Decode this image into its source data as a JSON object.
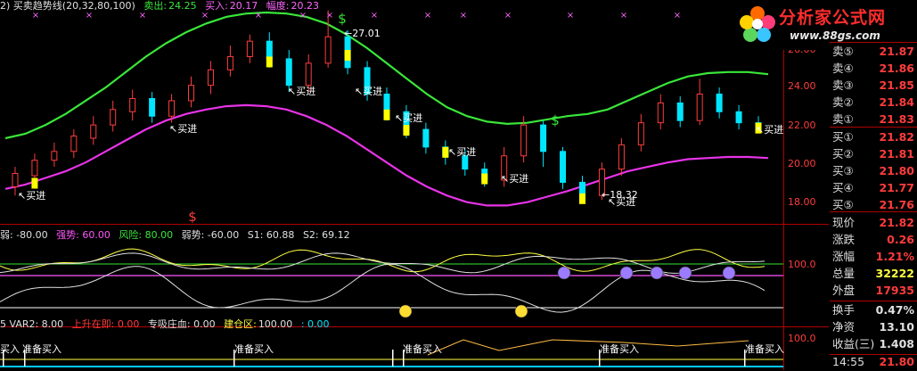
{
  "header_main": {
    "name": "2) 买卖趋势线(20,32,80,100)",
    "sell_label": "卖出:",
    "sell_value": "24.25",
    "buy_label": "买入:",
    "buy_value": "20.17",
    "range_label": "幅度:",
    "range_value": "20.23"
  },
  "header_ind1": {
    "weak1": "弱: -80.00",
    "strong": "强势: 60.00",
    "risk": "风险: 80.00",
    "weak2": "弱势: -60.00",
    "s1": "S1: 60.88",
    "s2": "S2: 69.12"
  },
  "header_ind2": {
    "var2": "5  VAR2: 8.00",
    "rise": "上升在即: 0.00",
    "absorb": "专吸庄血: 0.00",
    "build_label": "建仓区:",
    "build_value": "100.00",
    "tail": ": 0.00"
  },
  "main_axis": [
    "26.00",
    "24.00",
    "22.00",
    "20.00",
    "18.00"
  ],
  "ind1_axis": "100.0",
  "ind2_axis": "100.0",
  "price_panel": {
    "sell_rows": [
      {
        "label": "卖⑤",
        "value": "21.87"
      },
      {
        "label": "卖④",
        "value": "21.86"
      },
      {
        "label": "卖③",
        "value": "21.85"
      },
      {
        "label": "卖②",
        "value": "21.84"
      },
      {
        "label": "卖①",
        "value": "21.83"
      }
    ],
    "buy_rows": [
      {
        "label": "买①",
        "value": "21.82"
      },
      {
        "label": "买②",
        "value": "21.81"
      },
      {
        "label": "买③",
        "value": "21.80"
      },
      {
        "label": "买④",
        "value": "21.77"
      },
      {
        "label": "买⑤",
        "value": "21.76"
      }
    ],
    "stats": [
      {
        "label": "现价",
        "value": "21.82",
        "color": "#ff3c3c"
      },
      {
        "label": "涨跌",
        "value": "0.26",
        "color": "#ff3c3c"
      },
      {
        "label": "涨幅",
        "value": "1.21%",
        "color": "#ff3c3c"
      },
      {
        "label": "总量",
        "value": "32222",
        "color": "#ffff44"
      },
      {
        "label": "外盘",
        "value": "17935",
        "color": "#ff3c3c"
      }
    ],
    "stats2": [
      {
        "label": "换手",
        "value": "0.47%",
        "color": "#e0e0e0"
      },
      {
        "label": "净资",
        "value": "13.10",
        "color": "#e0e0e0"
      },
      {
        "label": "收益(三)",
        "value": "1.408",
        "color": "#e0e0e0"
      }
    ],
    "time": "14:55",
    "time_value": "21.80"
  },
  "logo": {
    "title": "分析家公式网",
    "url": "www.88gs.com"
  },
  "annotations": {
    "buy_in": "买进",
    "high_price": "27.01",
    "low_price": "18.32",
    "prepare_buy": "准备买入",
    "prepare_buy_short": "买入"
  },
  "colors": {
    "up": "#ff3c3c",
    "down": "#00e5ff",
    "signal": "#ffff00",
    "upper_band": "#39e639",
    "lower_band": "#e833e8",
    "background": "#000000"
  },
  "chart_data": {
    "type": "line",
    "ylim": [
      17.6,
      26.9
    ],
    "upper_band": [
      21.2,
      21.4,
      21.8,
      22.3,
      22.9,
      23.5,
      24.2,
      24.9,
      25.5,
      26.0,
      26.4,
      26.7,
      26.85,
      26.9,
      26.85,
      26.7,
      26.4,
      25.9,
      25.3,
      24.6,
      23.9,
      23.2,
      22.6,
      22.2,
      21.95,
      21.85,
      21.9,
      22.05,
      22.2,
      22.3,
      22.5,
      22.9,
      23.3,
      23.7,
      24.0,
      24.15,
      24.2,
      24.2,
      24.1
    ],
    "lower_band": [
      18.9,
      19.1,
      19.4,
      19.7,
      20.1,
      20.6,
      21.1,
      21.6,
      22.0,
      22.3,
      22.5,
      22.65,
      22.7,
      22.65,
      22.5,
      22.2,
      21.8,
      21.3,
      20.7,
      20.1,
      19.5,
      19.0,
      18.6,
      18.3,
      18.15,
      18.15,
      18.3,
      18.55,
      18.8,
      19.1,
      19.4,
      19.7,
      19.9,
      20.1,
      20.25,
      20.3,
      20.35,
      20.35,
      20.3
    ],
    "candles": [
      {
        "o": 19.0,
        "c": 19.6,
        "h": 19.9,
        "l": 18.6
      },
      {
        "o": 19.5,
        "c": 20.2,
        "h": 20.5,
        "l": 19.2
      },
      {
        "o": 20.2,
        "c": 20.6,
        "h": 21.0,
        "l": 19.9
      },
      {
        "o": 20.6,
        "c": 21.3,
        "h": 21.6,
        "l": 20.3
      },
      {
        "o": 21.2,
        "c": 21.8,
        "h": 22.2,
        "l": 20.9
      },
      {
        "o": 21.8,
        "c": 22.5,
        "h": 22.9,
        "l": 21.5
      },
      {
        "o": 22.4,
        "c": 23.0,
        "h": 23.4,
        "l": 22.0
      },
      {
        "o": 23.0,
        "c": 22.2,
        "h": 23.3,
        "l": 21.9
      },
      {
        "o": 22.2,
        "c": 22.9,
        "h": 23.2,
        "l": 21.9
      },
      {
        "o": 22.9,
        "c": 23.6,
        "h": 24.0,
        "l": 22.6
      },
      {
        "o": 23.6,
        "c": 24.3,
        "h": 24.7,
        "l": 23.2
      },
      {
        "o": 24.3,
        "c": 24.9,
        "h": 25.4,
        "l": 24.0
      },
      {
        "o": 24.9,
        "c": 25.6,
        "h": 25.9,
        "l": 24.6
      },
      {
        "o": 25.6,
        "c": 24.8,
        "h": 26.0,
        "l": 24.4
      },
      {
        "o": 24.8,
        "c": 23.6,
        "h": 25.2,
        "l": 23.3
      },
      {
        "o": 23.6,
        "c": 24.6,
        "h": 25.0,
        "l": 23.3
      },
      {
        "o": 24.6,
        "c": 25.8,
        "h": 27.0,
        "l": 24.4
      },
      {
        "o": 25.8,
        "c": 24.4,
        "h": 26.1,
        "l": 24.1
      },
      {
        "o": 24.4,
        "c": 23.2,
        "h": 24.7,
        "l": 22.9
      },
      {
        "o": 23.2,
        "c": 22.4,
        "h": 23.5,
        "l": 22.0
      },
      {
        "o": 22.4,
        "c": 21.6,
        "h": 22.7,
        "l": 21.2
      },
      {
        "o": 21.6,
        "c": 20.8,
        "h": 21.9,
        "l": 20.5
      },
      {
        "o": 20.8,
        "c": 20.4,
        "h": 21.1,
        "l": 20.0
      },
      {
        "o": 20.4,
        "c": 19.8,
        "h": 20.7,
        "l": 19.5
      },
      {
        "o": 19.8,
        "c": 19.3,
        "h": 20.1,
        "l": 19.0
      },
      {
        "o": 19.3,
        "c": 20.4,
        "h": 20.8,
        "l": 19.0
      },
      {
        "o": 20.4,
        "c": 21.8,
        "h": 22.2,
        "l": 20.1
      },
      {
        "o": 21.8,
        "c": 20.6,
        "h": 22.0,
        "l": 19.9
      },
      {
        "o": 20.6,
        "c": 19.2,
        "h": 20.8,
        "l": 18.9
      },
      {
        "o": 19.2,
        "c": 18.6,
        "h": 19.5,
        "l": 18.3
      },
      {
        "o": 18.6,
        "c": 19.8,
        "h": 20.1,
        "l": 18.4
      },
      {
        "o": 19.8,
        "c": 20.9,
        "h": 21.2,
        "l": 19.5
      },
      {
        "o": 20.9,
        "c": 21.9,
        "h": 22.3,
        "l": 20.6
      },
      {
        "o": 21.9,
        "c": 22.8,
        "h": 23.2,
        "l": 21.6
      },
      {
        "o": 22.8,
        "c": 22.0,
        "h": 23.1,
        "l": 21.7
      },
      {
        "o": 22.0,
        "c": 23.2,
        "h": 23.9,
        "l": 21.8
      },
      {
        "o": 23.2,
        "c": 22.4,
        "h": 23.5,
        "l": 22.1
      },
      {
        "o": 22.4,
        "c": 21.9,
        "h": 22.7,
        "l": 21.6
      },
      {
        "o": 21.9,
        "c": 21.82,
        "h": 22.2,
        "l": 21.6
      }
    ],
    "ind1_reference_levels": [
      100.0
    ]
  }
}
